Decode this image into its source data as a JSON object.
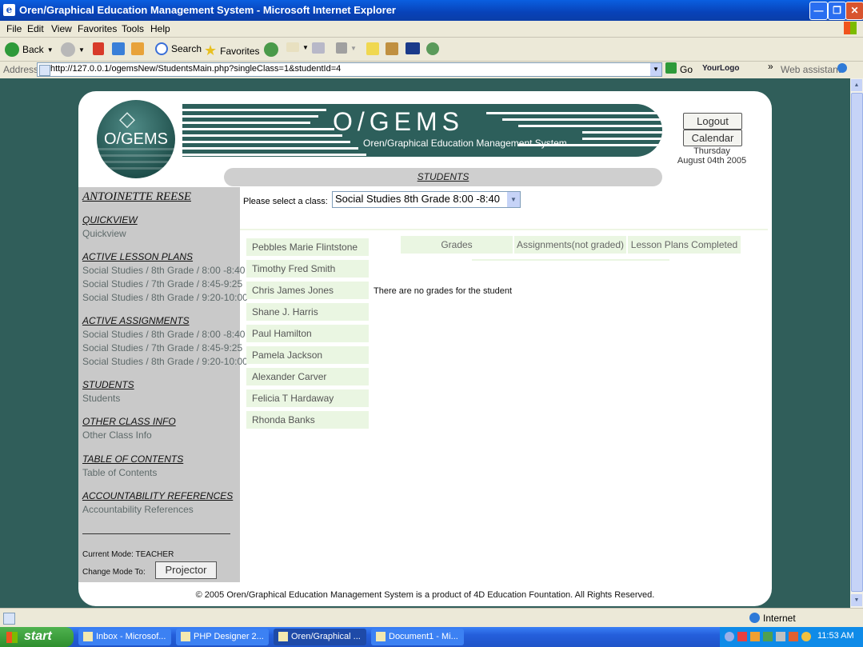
{
  "window": {
    "title": "Oren/Graphical Education Management System - Microsoft Internet Explorer"
  },
  "menu": [
    "File",
    "Edit",
    "View",
    "Favorites",
    "Tools",
    "Help"
  ],
  "toolbar": {
    "back": "Back",
    "search": "Search",
    "favorites": "Favorites"
  },
  "address": {
    "label": "Address",
    "url": "http://127.0.0.1/ogemsNew/StudentsMain.php?singleClass=1&studentId=4",
    "go": "Go",
    "yourlogo": "YourLogo",
    "web_assistant": "Web assistant"
  },
  "header": {
    "logo_text": "O/GEMS",
    "banner_title": "O/GEMS",
    "banner_subtitle": "Oren/Graphical Education Management System",
    "logout": "Logout",
    "calendar": "Calendar",
    "day": "Thursday",
    "date": "August 04th 2005",
    "section": "STUDENTS"
  },
  "sidebar": {
    "user": "ANTOINETTE REESE",
    "sections": [
      {
        "heading": "QUICKVIEW",
        "links": [
          "Quickview"
        ]
      },
      {
        "heading": "ACTIVE LESSON PLANS",
        "links": [
          "Social Studies / 8th Grade / 8:00 -8:40",
          "Social Studies / 7th Grade / 8:45-9:25",
          "Social Studies / 8th Grade / 9:20-10:00"
        ]
      },
      {
        "heading": "ACTIVE ASSIGNMENTS",
        "links": [
          "Social Studies / 8th Grade / 8:00 -8:40",
          "Social Studies / 7th Grade / 8:45-9:25",
          "Social Studies / 8th Grade / 9:20-10:00"
        ]
      },
      {
        "heading": "STUDENTS",
        "links": [
          "Students"
        ]
      },
      {
        "heading": "OTHER CLASS INFO",
        "links": [
          "Other Class Info"
        ]
      },
      {
        "heading": "TABLE OF CONTENTS",
        "links": [
          "Table of Contents"
        ]
      },
      {
        "heading": "ACCOUNTABILITY REFERENCES",
        "links": [
          "Accountability References"
        ]
      }
    ],
    "current_mode": "Current Mode: TEACHER",
    "change_mode": "Change Mode To:",
    "projector": "Projector"
  },
  "main": {
    "select_label": "Please select a class:",
    "selected_class": "Social Studies 8th Grade 8:00 -8:40",
    "students": [
      "Pebbles Marie Flintstone",
      "Timothy Fred Smith",
      "Chris James Jones",
      "Shane J. Harris",
      "Paul Hamilton",
      "Pamela Jackson",
      "Alexander Carver",
      "Felicia T Hardaway",
      "Rhonda Banks"
    ],
    "grade_tabs": [
      "Grades",
      "Assignments(not graded)",
      "Lesson Plans Completed"
    ],
    "no_grades": "There are no grades for the student"
  },
  "footer": "© 2005 Oren/Graphical Education Management System is a product of 4D Education Fountation. All Rights Reserved.",
  "statusbar": {
    "zone": "Internet"
  },
  "taskbar": {
    "start": "start",
    "tasks": [
      "Inbox - Microsof...",
      "PHP Designer 2...",
      "Oren/Graphical ...",
      "Document1 - Mi..."
    ],
    "clock": "11:53 AM"
  }
}
